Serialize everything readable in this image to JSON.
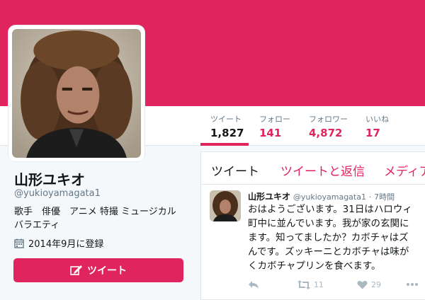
{
  "colors": {
    "accent": "#e0245e",
    "text": "#14171a",
    "muted": "#657786",
    "background": "#f5f8fa"
  },
  "profile": {
    "name": "山形ユキオ",
    "handle": "@yukioyamagata1",
    "bio_lines": [
      "歌手　俳優　アニメ 特撮 ミュージカル",
      "バラエティ"
    ],
    "joined": "2014年9月に登録",
    "tweet_button": "ツイート"
  },
  "stats": [
    {
      "label": "ツイート",
      "value": "1,827"
    },
    {
      "label": "フォロー",
      "value": "141"
    },
    {
      "label": "フォロワー",
      "value": "4,872"
    },
    {
      "label": "いいね",
      "value": "17"
    }
  ],
  "timeline": {
    "tabs": [
      "ツイート",
      "ツイートと返信",
      "メディア"
    ],
    "tweet": {
      "name": "山形ユキオ",
      "handle": "@yukioyamagata1",
      "time": "7時間",
      "lines": [
        "おはようございます。31日はハロウィ",
        "町中に並んでいます。我が家の玄関に",
        "ます。知ってましたか？カボチャはズ",
        "んです。ズッキーニとカボチャは味が",
        "くカボチャプリンを食べます。"
      ],
      "retweets": "11",
      "likes": "29"
    }
  },
  "icons": [
    "calendar-icon",
    "compose-icon",
    "reply-icon",
    "retweet-icon",
    "heart-icon",
    "more-icon"
  ]
}
